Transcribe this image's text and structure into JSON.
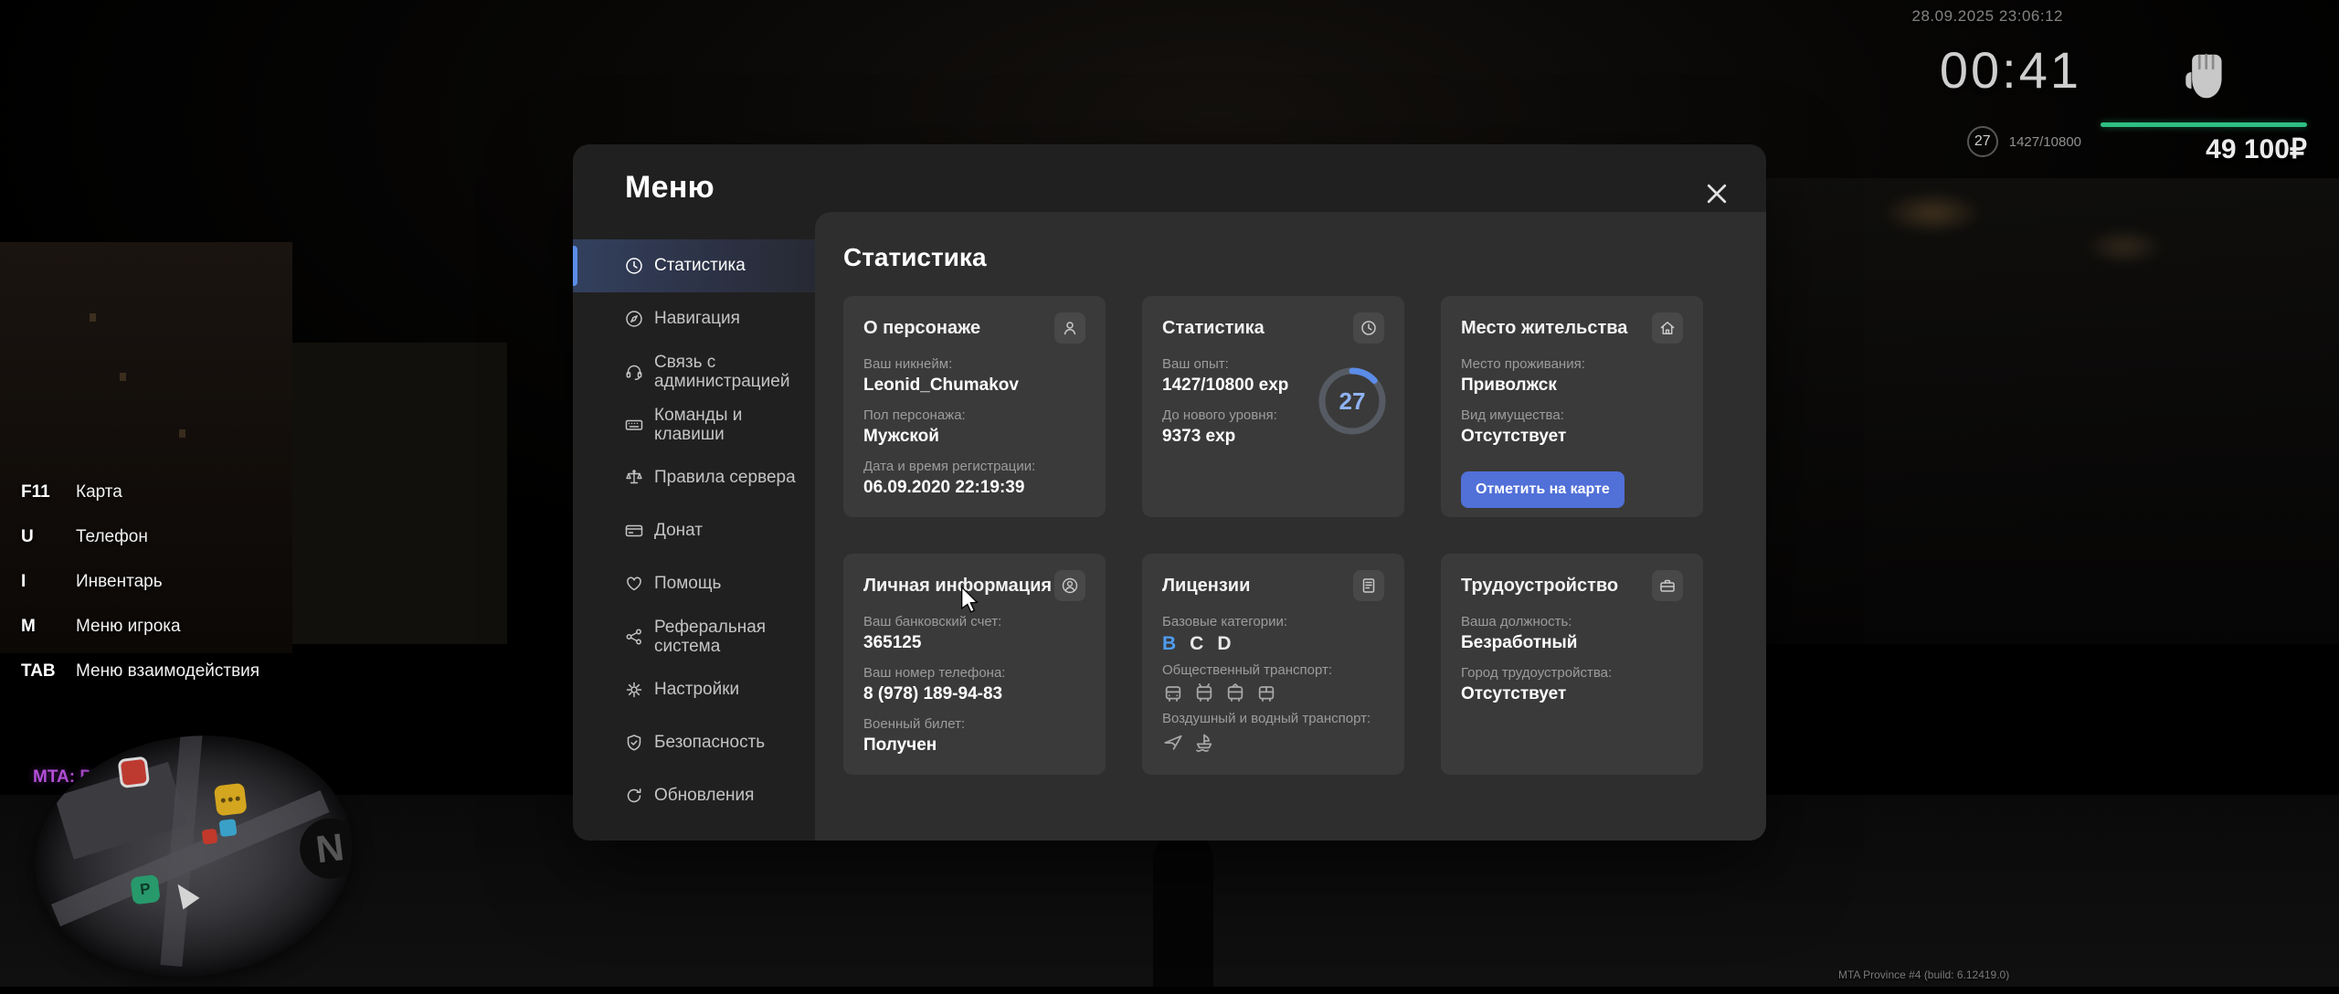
{
  "colors": {
    "accent_blue": "#5b8ce8",
    "button_blue": "#5170d8",
    "license_active_blue": "#4f9cf0",
    "exp_bar_green": "#2fbf83",
    "brand_purple": "#b44fd8"
  },
  "hud": {
    "datetime": "28.09.2025 23:06:12",
    "timer": "00:41",
    "level": "27",
    "exp": "1427/10800",
    "money": "49 100₽",
    "fist_icon": "fist-icon",
    "hotkeys": [
      {
        "key": "F11",
        "label": "Карта"
      },
      {
        "key": "U",
        "label": "Телефон"
      },
      {
        "key": "I",
        "label": "Инвентарь"
      },
      {
        "key": "M",
        "label": "Меню игрока"
      },
      {
        "key": "TAB",
        "label": "Меню взаимодействия"
      }
    ],
    "brand": "MTA: Province Demo",
    "build": "MTA Province #4 (build: 6.12419.0)",
    "minimap": {
      "compass": "N",
      "parking": "P"
    }
  },
  "menu": {
    "title": "Меню",
    "close_icon": "close-icon",
    "sidebar": [
      {
        "label": "Статистика",
        "icon": "stats-icon",
        "active": true
      },
      {
        "label": "Навигация",
        "icon": "navigation-icon",
        "active": false
      },
      {
        "label": "Связь с администрацией",
        "icon": "headset-icon",
        "active": false
      },
      {
        "label": "Команды и клавиши",
        "icon": "keyboard-icon",
        "active": false
      },
      {
        "label": "Правила сервера",
        "icon": "scales-icon",
        "active": false
      },
      {
        "label": "Донат",
        "icon": "card-icon",
        "active": false
      },
      {
        "label": "Помощь",
        "icon": "heart-icon",
        "active": false
      },
      {
        "label": "Реферальная система",
        "icon": "share-icon",
        "active": false
      },
      {
        "label": "Настройки",
        "icon": "gear-icon",
        "active": false
      },
      {
        "label": "Безопасность",
        "icon": "shield-icon",
        "active": false
      },
      {
        "label": "Обновления",
        "icon": "refresh-icon",
        "active": false
      }
    ],
    "content": {
      "heading": "Статистика",
      "cards": {
        "character": {
          "title": "О персонаже",
          "icon": "person-icon",
          "fields": [
            {
              "label": "Ваш никнейм:",
              "value": "Leonid_Chumakov"
            },
            {
              "label": "Пол персонажа:",
              "value": "Мужской"
            },
            {
              "label": "Дата и время регистрации:",
              "value": "06.09.2020 22:19:39"
            }
          ]
        },
        "stats": {
          "title": "Статистика",
          "icon": "clock-icon",
          "fields": [
            {
              "label": "Ваш опыт:",
              "value": "1427/10800 exp"
            },
            {
              "label": "До нового уровня:",
              "value": "9373 exp"
            }
          ],
          "level": "27",
          "progress_percent": 13
        },
        "residence": {
          "title": "Место жительства",
          "icon": "home-icon",
          "fields": [
            {
              "label": "Место проживания:",
              "value": "Приволжск"
            },
            {
              "label": "Вид имущества:",
              "value": "Отсутствует"
            }
          ],
          "button": "Отметить на карте"
        },
        "personal": {
          "title": "Личная информация",
          "icon": "profile-icon",
          "fields": [
            {
              "label": "Ваш банковский счет:",
              "value": "365125"
            },
            {
              "label": "Ваш номер телефона:",
              "value": "8 (978) 189-94-83"
            },
            {
              "label": "Военный билет:",
              "value": "Получен"
            }
          ]
        },
        "licenses": {
          "title": "Лицензии",
          "icon": "document-icon",
          "categories_label": "Базовые категории:",
          "categories": [
            {
              "label": "B",
              "highlighted": true
            },
            {
              "label": "C",
              "highlighted": false
            },
            {
              "label": "D",
              "highlighted": false
            }
          ],
          "public_transport_label": "Общественный транспорт:",
          "public_transport_icons": [
            "bus-icon",
            "trolleybus-icon",
            "tram-icon",
            "shuttle-icon"
          ],
          "air_water_label": "Воздушный и водный транспорт:",
          "air_water_icons": [
            "plane-icon",
            "ship-icon"
          ]
        },
        "employment": {
          "title": "Трудоустройство",
          "icon": "briefcase-icon",
          "fields": [
            {
              "label": "Ваша должность:",
              "value": "Безработный"
            },
            {
              "label": "Город трудоустройства:",
              "value": "Отсутствует"
            }
          ]
        }
      }
    }
  }
}
